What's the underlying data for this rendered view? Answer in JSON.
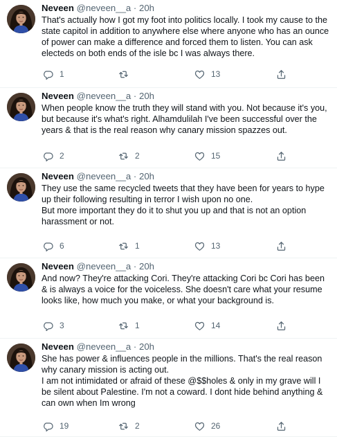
{
  "tweets": [
    {
      "name": "Neveen",
      "handle": "@neveen__a",
      "time": "20h",
      "lines": [
        "That's actually how I got my foot into politics locally. I took my cause to the state capitol in addition to anywhere else where anyone who has an ounce of power can make a difference and forced them to listen. You can ask electeds on both ends of the isle bc I was always there."
      ],
      "replies": "1",
      "retweets": "",
      "likes": "13"
    },
    {
      "name": "Neveen",
      "handle": "@neveen__a",
      "time": "20h",
      "lines": [
        "When people know the truth they will stand with you. Not because it's you, but because it's what's right. Alhamdulilah I've been successful over the years & that is the real reason why canary mission spazzes out."
      ],
      "replies": "2",
      "retweets": "2",
      "likes": "15"
    },
    {
      "name": "Neveen",
      "handle": "@neveen__a",
      "time": "20h",
      "lines": [
        "They use the same recycled tweets that they have been for years to hype up their following resulting in terror I wish upon no one.",
        "But more important they do it to shut you up and that is not an option harassment or not."
      ],
      "replies": "6",
      "retweets": "1",
      "likes": "13"
    },
    {
      "name": "Neveen",
      "handle": "@neveen__a",
      "time": "20h",
      "lines": [
        "And now? They're attacking Cori. They're attacking Cori bc Cori has been & is always a voice for the voiceless. She doesn't care what your resume looks like, how much you make, or what your background is."
      ],
      "replies": "3",
      "retweets": "1",
      "likes": "14"
    },
    {
      "name": "Neveen",
      "handle": "@neveen__a",
      "time": "20h",
      "lines": [
        "She has power & influences people in the millions. That's the real reason why canary mission is acting out.",
        "I am not intimidated or afraid of these @$$holes & only in my grave will I be silent about Palestine. I'm not a coward. I dont hide behind anything & can own when Im wrong"
      ],
      "replies": "19",
      "retweets": "2",
      "likes": "26"
    }
  ],
  "icons": {
    "reply": "reply-icon",
    "retweet": "retweet-icon",
    "like": "like-icon",
    "share": "share-icon"
  },
  "colors": {
    "text": "#0f1419",
    "secondary": "#536471",
    "divider": "#eff3f4"
  }
}
